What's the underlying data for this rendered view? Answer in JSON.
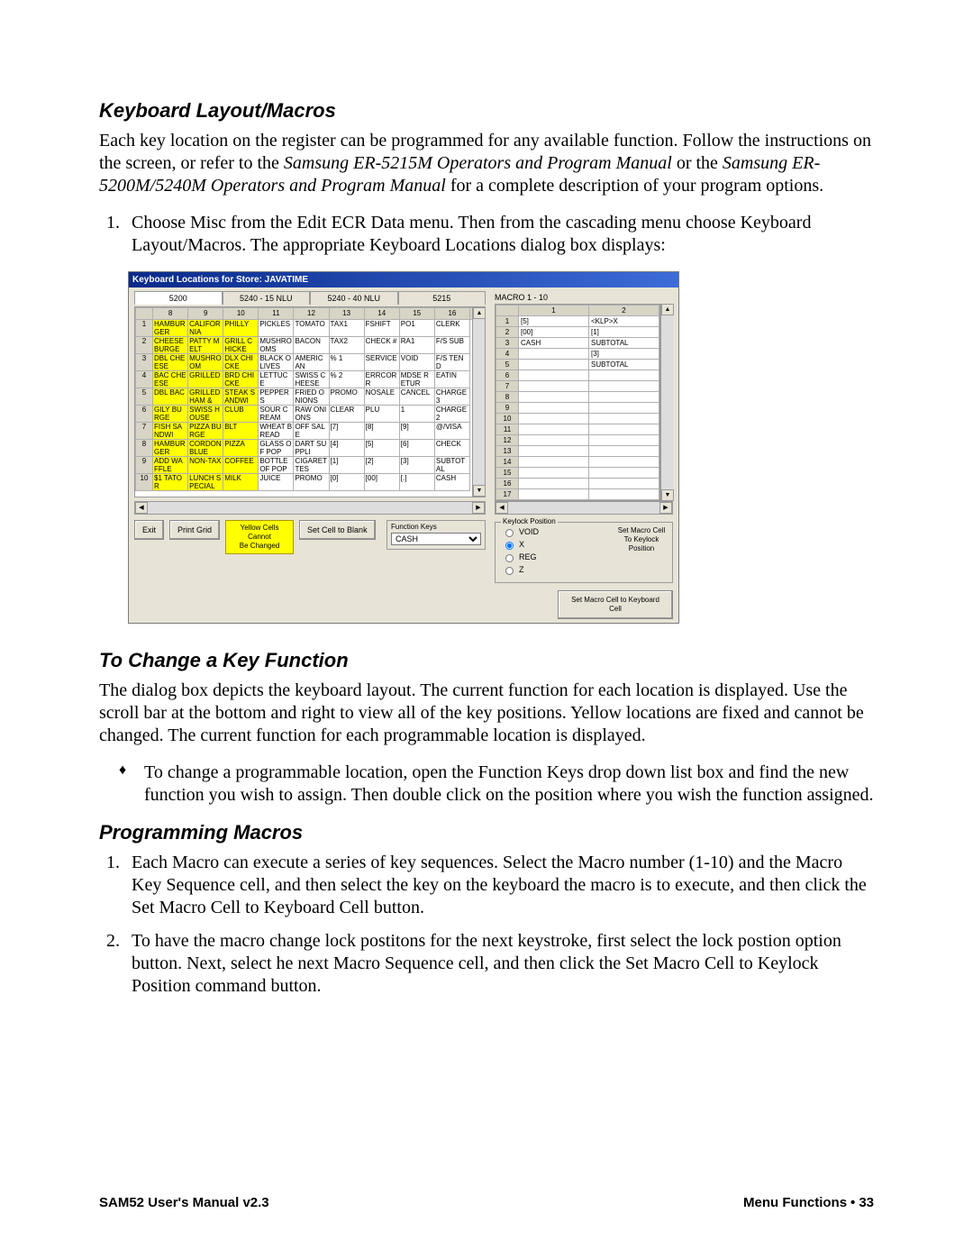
{
  "h2_1": "Keyboard Layout/Macros",
  "p1_a": "Each key location on the register can be programmed for any available function.  Follow the instructions on the screen, or refer to the ",
  "p1_i1": "Samsung ER-5215M Operators and Program Manual",
  "p1_b": " or the ",
  "p1_i2": "Samsung ER-5200M/5240M Operators and Program Manual",
  "p1_c": " for a complete description of your program options.",
  "step1_a": "Choose ",
  "step1_bold1": "Misc",
  "step1_b": " from the ",
  "step1_i1": "Edit ECR Data",
  "step1_c": " menu.  Then from the cascading menu choose ",
  "step1_bold2": "Keyboard Layout/Macros",
  "step1_d": ".  The appropriate ",
  "step1_i2": "Keyboard Locations",
  "step1_e": " dialog box displays:",
  "h2_2": "To Change a Key Function",
  "p2": "The dialog box depicts the keyboard layout.  The current function for each location is displayed.  Use the scroll bar at the bottom and right to view all of the key positions.  Yellow locations are fixed and cannot be changed.  The current function for each programmable location is displayed.",
  "bullet1": "To change a programmable location, open the Function Keys drop down list box and find the new function you wish to assign.  Then double click on the position where you wish the function assigned.",
  "h2_3": "Programming Macros",
  "pm_step1_a": "Each Macro can execute a series of key sequences.  Select the Macro number (1-10) and the Macro Key Sequence cell, and then select the key on the keyboard the macro is to execute, and then click the ",
  "pm_step1_bold": "Set Macro Cell to Keyboard Cell",
  "pm_step1_b": " button.",
  "pm_step2_a": "To have the macro change lock postitons for the next keystroke, first select the lock postion option button.  Next, select he next Macro Sequence cell, and then click the ",
  "pm_step2_bold": "Set Macro Cell to Keylock Position",
  "pm_step2_b": " command button.",
  "footer_left": "SAM52 User's Manual v2.3",
  "footer_right_a": "Menu Functions",
  "footer_right_b": "33",
  "dlg": {
    "title": "Keyboard Locations for Store: JAVATIME",
    "tabs": [
      "5200",
      "5240 - 15 NLU",
      "5240 - 40 NLU",
      "5215"
    ],
    "col_headers": [
      "8",
      "9",
      "10",
      "11",
      "12",
      "13",
      "14",
      "15",
      "16"
    ],
    "rows": [
      {
        "n": "1",
        "c": [
          {
            "t": "HAMBURGER",
            "y": 1
          },
          {
            "t": "CALIFORNIA",
            "y": 1
          },
          {
            "t": "PHILLY",
            "y": 1
          },
          {
            "t": "PICKLES"
          },
          {
            "t": "TOMATO"
          },
          {
            "t": "TAX1"
          },
          {
            "t": "FSHIFT"
          },
          {
            "t": "PO1"
          },
          {
            "t": "CLERK"
          }
        ]
      },
      {
        "n": "2",
        "c": [
          {
            "t": "CHEESE BURGE",
            "y": 1
          },
          {
            "t": "PATTY MELT",
            "y": 1
          },
          {
            "t": "GRILL CHICKE",
            "y": 1
          },
          {
            "t": "MUSHROOMS"
          },
          {
            "t": "BACON"
          },
          {
            "t": "TAX2"
          },
          {
            "t": "CHECK #"
          },
          {
            "t": "RA1"
          },
          {
            "t": "F/S SUB"
          }
        ]
      },
      {
        "n": "3",
        "c": [
          {
            "t": "DBL CHEESE",
            "y": 1
          },
          {
            "t": "MUSHROOM",
            "y": 1
          },
          {
            "t": "DLX CHICKE",
            "y": 1
          },
          {
            "t": "BLACK OLIVES"
          },
          {
            "t": "AMERICAN"
          },
          {
            "t": "% 1"
          },
          {
            "t": "SERVICE"
          },
          {
            "t": "VOID"
          },
          {
            "t": "F/S TEND"
          }
        ]
      },
      {
        "n": "4",
        "c": [
          {
            "t": "BAC CHEESE",
            "y": 1
          },
          {
            "t": "GRILLED",
            "y": 1
          },
          {
            "t": "BRD CHICKE",
            "y": 1
          },
          {
            "t": "LETTUCE"
          },
          {
            "t": "SWISS CHEESE"
          },
          {
            "t": "% 2"
          },
          {
            "t": "ERRCORR"
          },
          {
            "t": "MDSE RETUR"
          },
          {
            "t": "EATIN"
          }
        ]
      },
      {
        "n": "5",
        "c": [
          {
            "t": "DBL BAC",
            "y": 1
          },
          {
            "t": "GRILLED HAM &",
            "y": 1
          },
          {
            "t": "STEAK SANDWI",
            "y": 1
          },
          {
            "t": "PEPPERS"
          },
          {
            "t": "FRIED ONIONS"
          },
          {
            "t": "PROMO"
          },
          {
            "t": "NOSALE"
          },
          {
            "t": "CANCEL"
          },
          {
            "t": "CHARGE3"
          }
        ]
      },
      {
        "n": "6",
        "c": [
          {
            "t": "GILY BURGE",
            "y": 1
          },
          {
            "t": "SWISS HOUSE",
            "y": 1
          },
          {
            "t": "CLUB",
            "y": 1
          },
          {
            "t": "SOUR CREAM"
          },
          {
            "t": "RAW ONIONS"
          },
          {
            "t": "CLEAR"
          },
          {
            "t": "PLU"
          },
          {
            "t": "1"
          },
          {
            "t": "CHARGE2"
          }
        ]
      },
      {
        "n": "7",
        "c": [
          {
            "t": "FISH SANDWI",
            "y": 1
          },
          {
            "t": "PIZZA BURGE",
            "y": 1
          },
          {
            "t": "BLT",
            "y": 1
          },
          {
            "t": "WHEAT BREAD"
          },
          {
            "t": "OFF SALE"
          },
          {
            "t": "[7]"
          },
          {
            "t": "[8]"
          },
          {
            "t": "[9]"
          },
          {
            "t": "@/VISA"
          }
        ]
      },
      {
        "n": "8",
        "c": [
          {
            "t": "HAMBURGER",
            "y": 1
          },
          {
            "t": "CORDON BLUE",
            "y": 1
          },
          {
            "t": "PIZZA",
            "y": 1
          },
          {
            "t": "GLASS OF POP"
          },
          {
            "t": "DART SUPPLI"
          },
          {
            "t": "[4]"
          },
          {
            "t": "[5]"
          },
          {
            "t": "[6]"
          },
          {
            "t": "CHECK"
          }
        ]
      },
      {
        "n": "9",
        "c": [
          {
            "t": "ADD WAFFLE",
            "y": 1
          },
          {
            "t": "NON-TAX",
            "y": 1
          },
          {
            "t": "COFFEE",
            "y": 1
          },
          {
            "t": "BOTTLE OF POP"
          },
          {
            "t": "CIGARETTES"
          },
          {
            "t": "[1]"
          },
          {
            "t": "[2]"
          },
          {
            "t": "[3]"
          },
          {
            "t": "SUBTOTAL"
          }
        ]
      },
      {
        "n": "10",
        "c": [
          {
            "t": "$1 TATOR",
            "y": 1
          },
          {
            "t": "LUNCH SPECIAL",
            "y": 1
          },
          {
            "t": "MILK",
            "y": 1
          },
          {
            "t": "JUICE"
          },
          {
            "t": "PROMO"
          },
          {
            "t": "[0]"
          },
          {
            "t": "[00]"
          },
          {
            "t": "[.]"
          },
          {
            "t": "CASH"
          }
        ]
      }
    ],
    "btn_exit": "Exit",
    "btn_print": "Print Grid",
    "note_l1": "Yellow Cells Cannot",
    "note_l2": "Be Changed",
    "btn_setblank": "Set Cell to Blank",
    "fkeys_label": "Function Keys",
    "fkeys_value": "CASH",
    "macro_title": "MACRO 1 - 10",
    "macro_cols": [
      "1",
      "2"
    ],
    "macro_rows": [
      {
        "n": "1",
        "c": [
          "[5]",
          "<KLP>X"
        ]
      },
      {
        "n": "2",
        "c": [
          "[00]",
          "[1]"
        ]
      },
      {
        "n": "3",
        "c": [
          "CASH",
          "SUBTOTAL"
        ]
      },
      {
        "n": "4",
        "c": [
          "",
          "[3]"
        ]
      },
      {
        "n": "5",
        "c": [
          "",
          "SUBTOTAL"
        ]
      },
      {
        "n": "6",
        "c": [
          "",
          ""
        ]
      },
      {
        "n": "7",
        "c": [
          "",
          ""
        ]
      },
      {
        "n": "8",
        "c": [
          "",
          ""
        ]
      },
      {
        "n": "9",
        "c": [
          "",
          ""
        ]
      },
      {
        "n": "10",
        "c": [
          "",
          ""
        ]
      },
      {
        "n": "11",
        "c": [
          "",
          ""
        ]
      },
      {
        "n": "12",
        "c": [
          "",
          ""
        ]
      },
      {
        "n": "13",
        "c": [
          "",
          ""
        ]
      },
      {
        "n": "14",
        "c": [
          "",
          ""
        ]
      },
      {
        "n": "15",
        "c": [
          "",
          ""
        ]
      },
      {
        "n": "16",
        "c": [
          "",
          ""
        ]
      },
      {
        "n": "17",
        "c": [
          "",
          ""
        ]
      }
    ],
    "keylock_legend": "Keylock Position",
    "kl_void": "VOID",
    "kl_x": "X",
    "kl_reg": "REG",
    "kl_z": "Z",
    "kl_side": "Set Macro Cell To Keylock Position",
    "btn_setmacro": "Set Macro Cell to Keyboard Cell"
  }
}
